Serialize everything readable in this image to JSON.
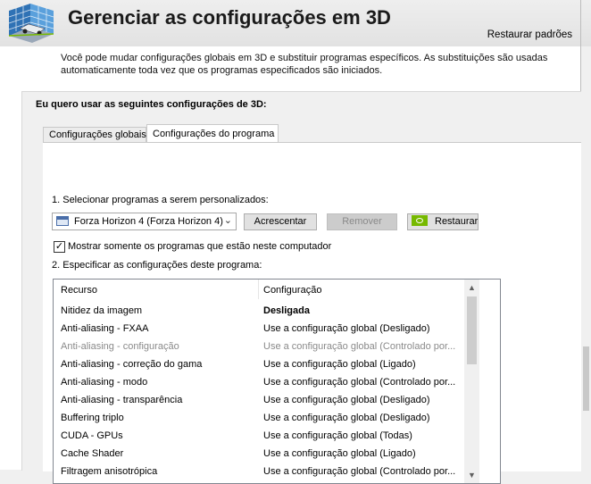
{
  "header": {
    "title": "Gerenciar as configurações em 3D",
    "restore_defaults": "Restaurar padrões"
  },
  "description": "Você pode mudar configurações globais em 3D e substituir programas específicos. As substituições são usadas automaticamente toda vez que os programas especificados são iniciados.",
  "panel": {
    "heading": "Eu quero usar as seguintes configurações de 3D:",
    "tabs": [
      {
        "label": "Configurações globais",
        "selected": false
      },
      {
        "label": "Configurações do programa",
        "selected": true
      }
    ]
  },
  "program": {
    "step1_label": "1. Selecionar programas a serem personalizados:",
    "selected_program": "Forza Horizon 4 (Forza Horizon 4)",
    "add_button": "Acrescentar",
    "remove_button": "Remover",
    "restore_button": "Restaurar",
    "show_only_checkbox": "Mostrar somente os programas que estão neste computador",
    "show_only_checked": true,
    "step2_label": "2. Especificar as configurações deste programa:"
  },
  "settings_table": {
    "columns": [
      "Recurso",
      "Configuração"
    ],
    "rows": [
      {
        "feature": "Nitidez da imagem",
        "value": "Desligada",
        "bold": true,
        "dim": false
      },
      {
        "feature": "Anti-aliasing - FXAA",
        "value": "Use a configuração global (Desligado)",
        "bold": false,
        "dim": false
      },
      {
        "feature": "Anti-aliasing - configuração",
        "value": "Use a configuração global (Controlado por...",
        "bold": false,
        "dim": true
      },
      {
        "feature": "Anti-aliasing - correção do gama",
        "value": "Use a configuração global (Ligado)",
        "bold": false,
        "dim": false
      },
      {
        "feature": "Anti-aliasing - modo",
        "value": "Use a configuração global (Controlado por...",
        "bold": false,
        "dim": false
      },
      {
        "feature": "Anti-aliasing - transparência",
        "value": "Use a configuração global (Desligado)",
        "bold": false,
        "dim": false
      },
      {
        "feature": "Buffering triplo",
        "value": "Use a configuração global (Desligado)",
        "bold": false,
        "dim": false
      },
      {
        "feature": "CUDA - GPUs",
        "value": "Use a configuração global (Todas)",
        "bold": false,
        "dim": false
      },
      {
        "feature": "Cache Shader",
        "value": "Use a configuração global (Ligado)",
        "bold": false,
        "dim": false
      },
      {
        "feature": "Filtragem anisotrópica",
        "value": "Use a configuração global (Controlado por...",
        "bold": false,
        "dim": false
      }
    ]
  },
  "icons": {
    "header": "nvidia-3d-settings-icon",
    "program_select": "game-program-icon",
    "restore": "nvidia-logo-icon"
  },
  "colors": {
    "nvidia_green": "#76b900"
  }
}
